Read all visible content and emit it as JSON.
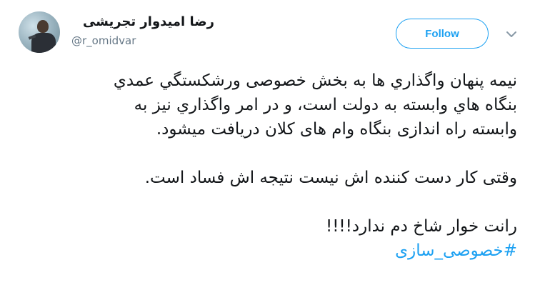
{
  "author": {
    "display_name": "رضا امیدوار تجریشی",
    "handle": "@r_omidvar"
  },
  "follow_button": {
    "label": "Follow"
  },
  "icons": {
    "avatar": "profile-photo",
    "menu": "chevron-down-icon"
  },
  "colors": {
    "accent": "#1da1f2",
    "text": "#14171a",
    "secondary_text": "#657786"
  },
  "tweet": {
    "lines": [
      "نيمه پنهان واگذاري ها به بخش خصوصی ورشکستگي عمدي",
      "بنگاه هاي وابسته به دولت است، و در امر واگذاري نیز به",
      "وابسته راه اندازی بنگاه وام های کلان دریافت میشود.",
      "وقتی کار دست کننده اش نیست نتیجه اش فساد است.",
      "رانت خوار شاخ دم ندارد!!!!"
    ],
    "hashtag": "#خصوصی_سازی"
  }
}
